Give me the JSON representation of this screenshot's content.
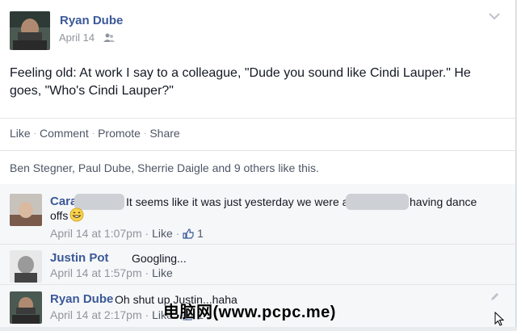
{
  "post": {
    "author": "Ryan Dube",
    "date": "April 14",
    "audience_icon": "friends-icon",
    "text": "Feeling old: At work I say to a colleague, \"Dude you sound like Cindi Lauper.\" He goes, \"Who's Cindi Lauper?\""
  },
  "actions": {
    "like": "Like",
    "comment": "Comment",
    "promote": "Promote",
    "share": "Share"
  },
  "likes_summary": "Ben Stegner, Paul Dube, Sherrie Daigle and 9 others like this.",
  "comments": [
    {
      "author": "Cara",
      "text_part1": "It seems like it was just yesterday we were at",
      "text_part2": "having dance",
      "text_part3": "offs",
      "emoji": "grin-emoji",
      "time": "April 14 at 1:07pm",
      "like_label": "Like",
      "like_count": "1"
    },
    {
      "author": "Justin Pot",
      "text": "Googling...",
      "time": "April 14 at 1:57pm",
      "like_label": "Like"
    },
    {
      "author": "Ryan Dube",
      "text": "Oh shut up Justin...haha",
      "time": "April 14 at 2:17pm",
      "like_label": "Like",
      "like_count": "1"
    }
  ],
  "watermark": "电脑网(www.pcpc.me)",
  "colors": {
    "link": "#3b5998",
    "meta": "#90949c",
    "text": "#141823"
  }
}
